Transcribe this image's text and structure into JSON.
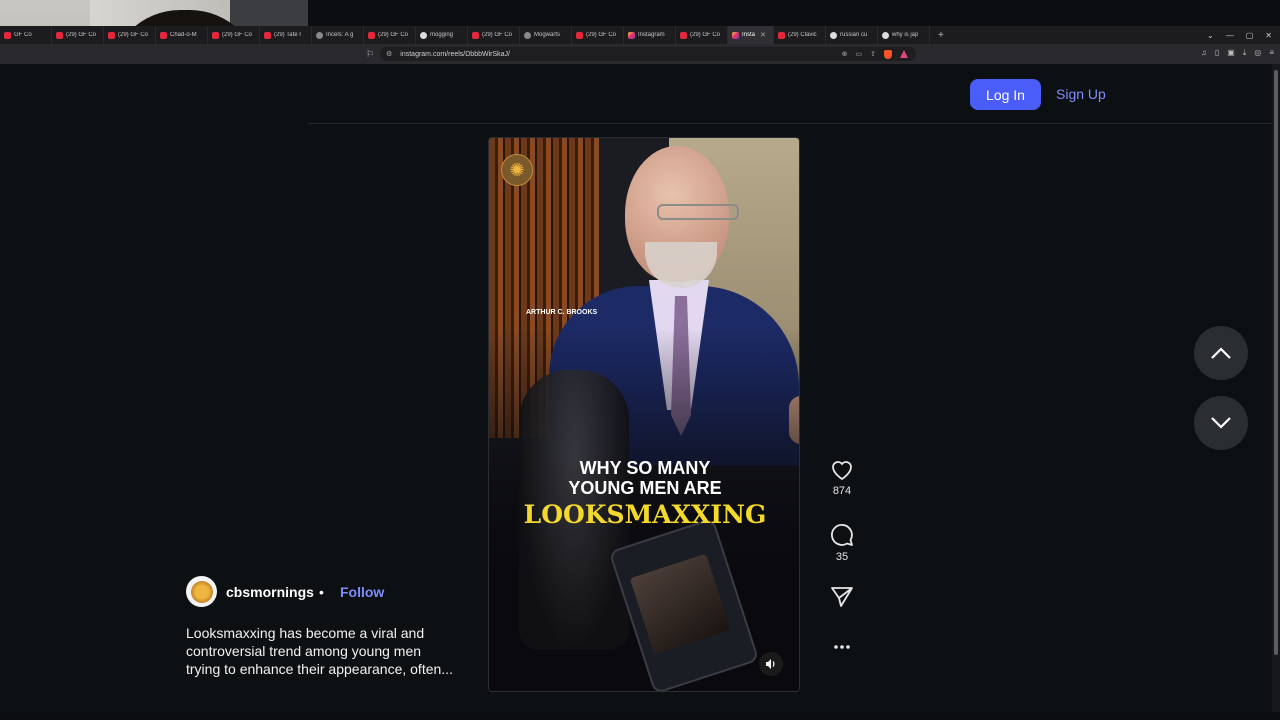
{
  "browser": {
    "tabs": [
      {
        "label": "GF Co",
        "icon": "youtube-icon",
        "active": false
      },
      {
        "label": "(29) GF Co",
        "icon": "youtube-icon",
        "active": false
      },
      {
        "label": "(29) GF Co",
        "icon": "youtube-icon",
        "active": false
      },
      {
        "label": "Chad-o-M",
        "icon": "youtube-icon",
        "active": false
      },
      {
        "label": "(29) GF Co",
        "icon": "youtube-icon",
        "active": false
      },
      {
        "label": "(29) Tate I",
        "icon": "youtube-icon",
        "active": false
      },
      {
        "label": "Incels: A g",
        "icon": "web-icon",
        "active": false
      },
      {
        "label": "(29) GF Co",
        "icon": "youtube-icon",
        "active": false
      },
      {
        "label": "mogging",
        "icon": "google-icon",
        "active": false
      },
      {
        "label": "(29) GF Co",
        "icon": "youtube-icon",
        "active": false
      },
      {
        "label": "Mogwarts",
        "icon": "web-icon",
        "active": false
      },
      {
        "label": "(29) GF Co",
        "icon": "youtube-icon",
        "active": false
      },
      {
        "label": "Instagram",
        "icon": "instagram-icon",
        "active": false
      },
      {
        "label": "(29) GF Co",
        "icon": "youtube-icon",
        "active": false
      },
      {
        "label": "Insta",
        "icon": "instagram-icon",
        "active": true
      },
      {
        "label": "(29) Clavic",
        "icon": "youtube-icon",
        "active": false
      },
      {
        "label": "russian cu",
        "icon": "google-icon",
        "active": false
      },
      {
        "label": "why is jap",
        "icon": "google-icon",
        "active": false
      }
    ],
    "new_tab": "+",
    "url": "instagram.com/reels/DbbbWirSkaJ/"
  },
  "header": {
    "login_label": "Log In",
    "signup_label": "Sign Up"
  },
  "reel": {
    "name_tag": "ARTHUR C. BROOKS",
    "headline_line1": "WHY SO MANY",
    "headline_line2": "YOUNG MEN ARE",
    "headline_accent": "LOOKSMAXXING",
    "accent_color": "#f4d92c"
  },
  "actions": {
    "likes": "874",
    "comments": "35"
  },
  "author": {
    "name": "cbsmornings",
    "separator": "•",
    "follow_label": "Follow",
    "caption": "Looksmaxxing has become a viral and controversial trend among young men trying to enhance their appearance, often..."
  },
  "colors": {
    "accent": "#4a5df9",
    "link": "#7d8dfa",
    "page_bg": "#0d1013"
  }
}
